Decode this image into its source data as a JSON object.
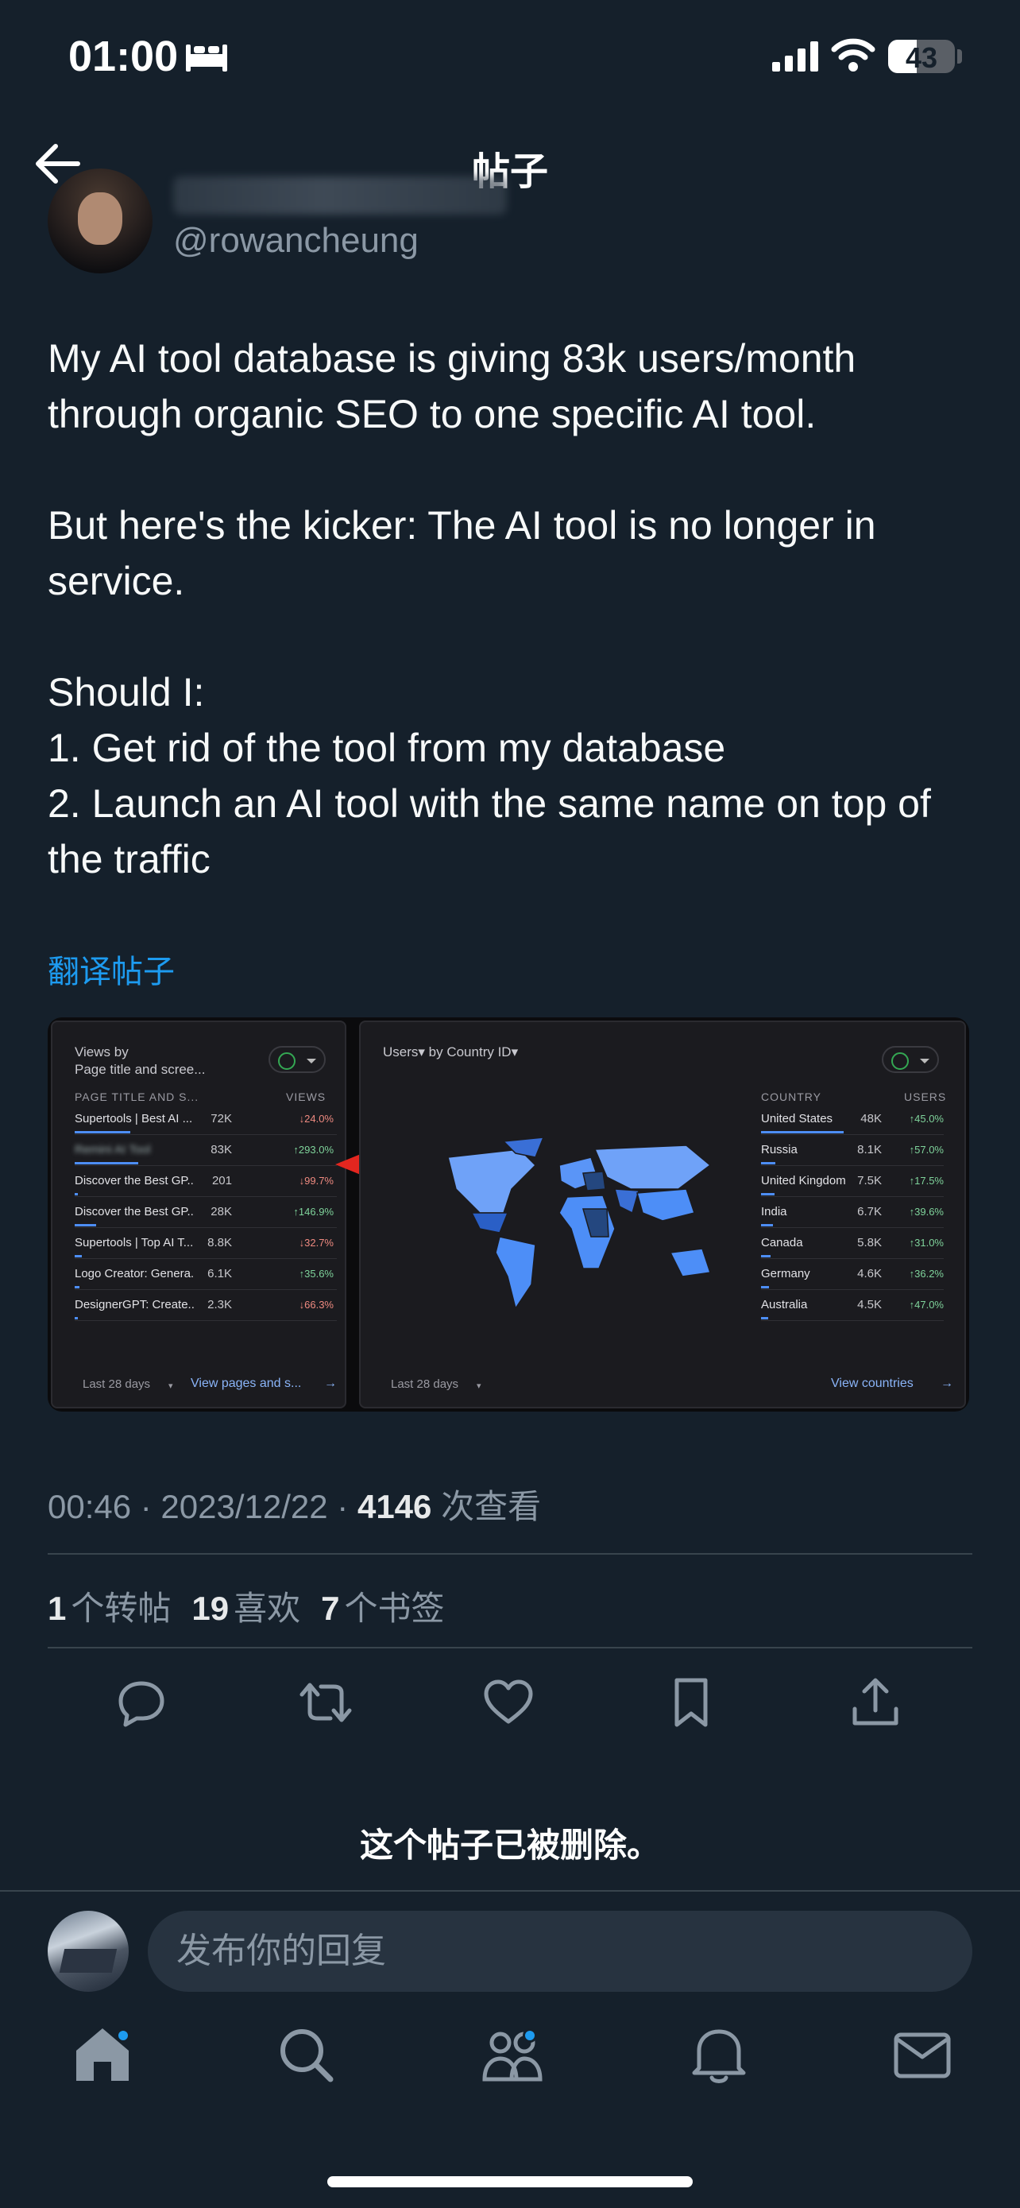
{
  "status_bar": {
    "time": "01:00",
    "battery": "43",
    "battery_level": 0.43
  },
  "header": {
    "title": "帖子"
  },
  "author": {
    "handle": "@rowancheung"
  },
  "tweet": {
    "paragraphs": [
      "My AI tool database is giving 83k users/month through organic SEO to one specific AI tool.",
      "But here's the kicker: The AI tool is no longer in service.",
      "Should I:\n1. Get rid of the tool from my database\n2. Launch an AI tool with the same name on top of the traffic"
    ],
    "translate_label": "翻译帖子"
  },
  "embedded_image": {
    "left_panel": {
      "title_line1": "Views by",
      "title_line2": "Page title and scree...",
      "col_name": "PAGE TITLE AND S...",
      "col_value": "VIEWS",
      "rows": [
        {
          "name": "Supertools | Best AI ...",
          "value": "72K",
          "delta": "↓24.0%",
          "dir": "down",
          "bar": 0.87
        },
        {
          "name": "Remini AI Tool",
          "value": "83K",
          "delta": "↑293.0%",
          "dir": "up",
          "bar": 1.0
        },
        {
          "name": "Discover the Best GP...",
          "value": "201",
          "delta": "↓99.7%",
          "dir": "down",
          "bar": 0.01
        },
        {
          "name": "Discover the Best GP...",
          "value": "28K",
          "delta": "↑146.9%",
          "dir": "up",
          "bar": 0.34
        },
        {
          "name": "Supertools | Top AI T...",
          "value": "8.8K",
          "delta": "↓32.7%",
          "dir": "down",
          "bar": 0.11
        },
        {
          "name": "Logo Creator: Genera...",
          "value": "6.1K",
          "delta": "↑35.6%",
          "dir": "up",
          "bar": 0.07
        },
        {
          "name": "DesignerGPT: Create...",
          "value": "2.3K",
          "delta": "↓66.3%",
          "dir": "down",
          "bar": 0.03
        }
      ],
      "footer_range": "Last 28 days",
      "footer_link": "View pages and s..."
    },
    "right_panel": {
      "title": "Users▾ by Country ID▾",
      "col_name": "COUNTRY",
      "col_value": "USERS",
      "rows": [
        {
          "name": "United States",
          "value": "48K",
          "delta": "↑45.0%",
          "dir": "up",
          "bar": 1.0
        },
        {
          "name": "Russia",
          "value": "8.1K",
          "delta": "↑57.0%",
          "dir": "up",
          "bar": 0.17
        },
        {
          "name": "United Kingdom",
          "value": "7.5K",
          "delta": "↑17.5%",
          "dir": "up",
          "bar": 0.16
        },
        {
          "name": "India",
          "value": "6.7K",
          "delta": "↑39.6%",
          "dir": "up",
          "bar": 0.14
        },
        {
          "name": "Canada",
          "value": "5.8K",
          "delta": "↑31.0%",
          "dir": "up",
          "bar": 0.12
        },
        {
          "name": "Germany",
          "value": "4.6K",
          "delta": "↑36.2%",
          "dir": "up",
          "bar": 0.1
        },
        {
          "name": "Australia",
          "value": "4.5K",
          "delta": "↑47.0%",
          "dir": "up",
          "bar": 0.09
        }
      ],
      "footer_range": "Last 28 days",
      "footer_link": "View countries"
    }
  },
  "meta": {
    "time_date": "00:46 · 2023/12/22 · ",
    "views_count": "4146",
    "views_label": " 次查看"
  },
  "stats": [
    {
      "count": "1",
      "label": "个转帖"
    },
    {
      "count": "19",
      "label": "喜欢"
    },
    {
      "count": "7",
      "label": "个书签"
    }
  ],
  "deleted_notice": "这个帖子已被删除。",
  "reply": {
    "placeholder": "发布你的回复"
  },
  "colors": {
    "background": "#15202b",
    "accent": "#1d9bf0",
    "muted": "#8b98a5",
    "divider": "#38444d"
  },
  "icons": [
    "back-arrow-icon",
    "reply-icon",
    "retweet-icon",
    "like-icon",
    "bookmark-icon",
    "share-icon",
    "home-icon",
    "search-icon",
    "communities-icon",
    "notifications-icon",
    "messages-icon"
  ]
}
